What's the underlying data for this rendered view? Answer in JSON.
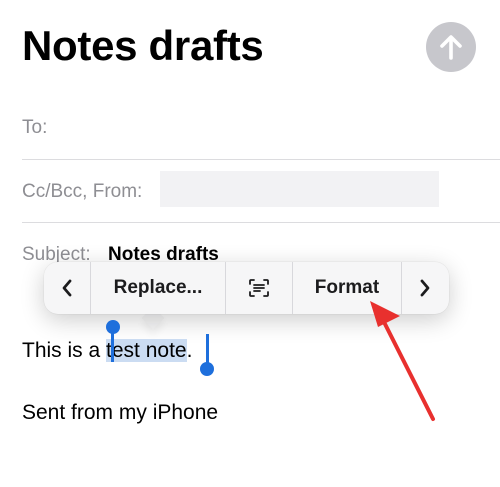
{
  "compose": {
    "title": "Notes drafts",
    "to_label": "To:",
    "cc_label": "Cc/Bcc, From:",
    "subject_label": "Subject:",
    "subject_value": "Notes drafts"
  },
  "edit_menu": {
    "replace_label": "Replace...",
    "format_label": "Format",
    "scan_text_icon": "scan-text-icon",
    "prev_icon": "chevron-left-icon",
    "next_icon": "chevron-right-icon"
  },
  "body": {
    "line1_before": "This is a ",
    "line1_selected": "test note",
    "line1_after": ".",
    "signature": "Sent from my iPhone"
  },
  "colors": {
    "selection": "#cbdcf2",
    "handle": "#1e6fdc",
    "send_button": "#c7c7cc",
    "annotation_arrow": "#e8302e"
  }
}
